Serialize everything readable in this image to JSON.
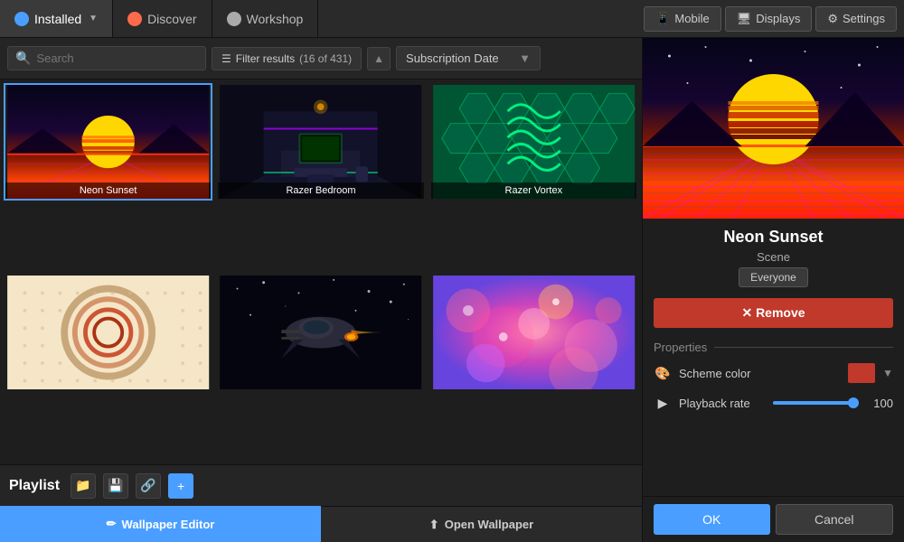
{
  "nav": {
    "tabs": [
      {
        "id": "installed",
        "label": "Installed",
        "icon": "installed",
        "active": true,
        "hasDropdown": true
      },
      {
        "id": "discover",
        "label": "Discover",
        "icon": "discover",
        "active": false
      },
      {
        "id": "workshop",
        "label": "Workshop",
        "icon": "workshop",
        "active": false
      }
    ],
    "right_tabs": [
      {
        "id": "mobile",
        "label": "Mobile",
        "icon": "📱"
      },
      {
        "id": "displays",
        "label": "Displays",
        "icon": "🖥"
      },
      {
        "id": "settings",
        "label": "Settings",
        "icon": "⚙"
      }
    ]
  },
  "filter_bar": {
    "search_placeholder": "Search",
    "filter_label": "Filter results",
    "filter_count": "16 of 431",
    "sort_label": "Subscription Date",
    "sort_arrow": "▼"
  },
  "wallpapers": [
    {
      "id": "neon-sunset",
      "label": "Neon Sunset",
      "selected": true,
      "row": 0,
      "col": 0
    },
    {
      "id": "razer-bedroom",
      "label": "Razer Bedroom",
      "selected": false,
      "row": 0,
      "col": 1
    },
    {
      "id": "razer-vortex",
      "label": "Razer Vortex",
      "selected": false,
      "row": 0,
      "col": 2
    },
    {
      "id": "abstract1",
      "label": "",
      "selected": false,
      "row": 1,
      "col": 0
    },
    {
      "id": "spaceship",
      "label": "",
      "selected": false,
      "row": 1,
      "col": 1
    },
    {
      "id": "bokeh",
      "label": "",
      "selected": false,
      "row": 1,
      "col": 2
    }
  ],
  "playlist": {
    "label": "Playlist",
    "buttons": [
      {
        "id": "folder",
        "icon": "📁",
        "title": "Open folder"
      },
      {
        "id": "save",
        "icon": "💾",
        "title": "Save"
      },
      {
        "id": "share",
        "icon": "🔗",
        "title": "Share"
      },
      {
        "id": "add",
        "icon": "+",
        "title": "Add"
      }
    ]
  },
  "bottom_bar": {
    "editor_label": "Wallpaper Editor",
    "open_label": "Open Wallpaper"
  },
  "detail": {
    "title": "Neon Sunset",
    "type": "Scene",
    "rating": "Everyone",
    "remove_label": "✕ Remove",
    "properties_label": "Properties",
    "scheme_color_label": "Scheme color",
    "scheme_color_value": "#c0392b",
    "playback_label": "Playback rate",
    "playback_value": "100"
  },
  "action_buttons": {
    "ok_label": "OK",
    "cancel_label": "Cancel"
  }
}
